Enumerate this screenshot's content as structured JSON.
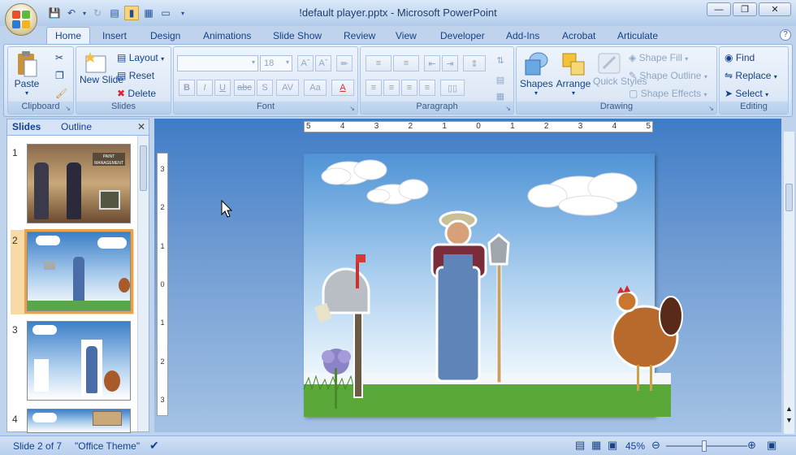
{
  "window": {
    "title": "!default player.pptx - Microsoft PowerPoint"
  },
  "tabs": [
    "Home",
    "Insert",
    "Design",
    "Animations",
    "Slide Show",
    "Review",
    "View",
    "Developer",
    "Add-Ins",
    "Acrobat",
    "Articulate"
  ],
  "active_tab": "Home",
  "ribbon": {
    "clipboard": {
      "label": "Clipboard",
      "paste": "Paste"
    },
    "slides": {
      "label": "Slides",
      "new_slide": "New Slide",
      "layout": "Layout",
      "reset": "Reset",
      "delete": "Delete"
    },
    "font": {
      "label": "Font",
      "font_size": "18",
      "bold": "B",
      "italic": "I",
      "underline": "U",
      "strike": "abc",
      "shadow": "S",
      "spacing": "AV",
      "case": "Aa"
    },
    "paragraph": {
      "label": "Paragraph"
    },
    "drawing": {
      "label": "Drawing",
      "shapes": "Shapes",
      "arrange": "Arrange",
      "quick_styles": "Quick Styles",
      "shape_fill": "Shape Fill",
      "shape_outline": "Shape Outline",
      "shape_effects": "Shape Effects"
    },
    "editing": {
      "label": "Editing",
      "find": "Find",
      "replace": "Replace",
      "select": "Select"
    }
  },
  "left_pane": {
    "tabs": [
      "Slides",
      "Outline"
    ],
    "slides": [
      {
        "num": "1",
        "banner": "PAINT MANAGEMENT"
      },
      {
        "num": "2"
      },
      {
        "num": "3"
      },
      {
        "num": "4"
      }
    ]
  },
  "ruler": {
    "h_labels": [
      "5",
      "4",
      "3",
      "2",
      "1",
      "0",
      "1",
      "2",
      "3",
      "4",
      "5"
    ],
    "v_labels": [
      "3",
      "2",
      "1",
      "0",
      "1",
      "2",
      "3"
    ]
  },
  "status": {
    "slide_info": "Slide 2 of 7",
    "theme": "\"Office Theme\"",
    "zoom": "45%"
  },
  "colors": {
    "accent": "#15428b",
    "selection": "#e9a24a",
    "ribbon_bg": "#dbe7f6"
  }
}
